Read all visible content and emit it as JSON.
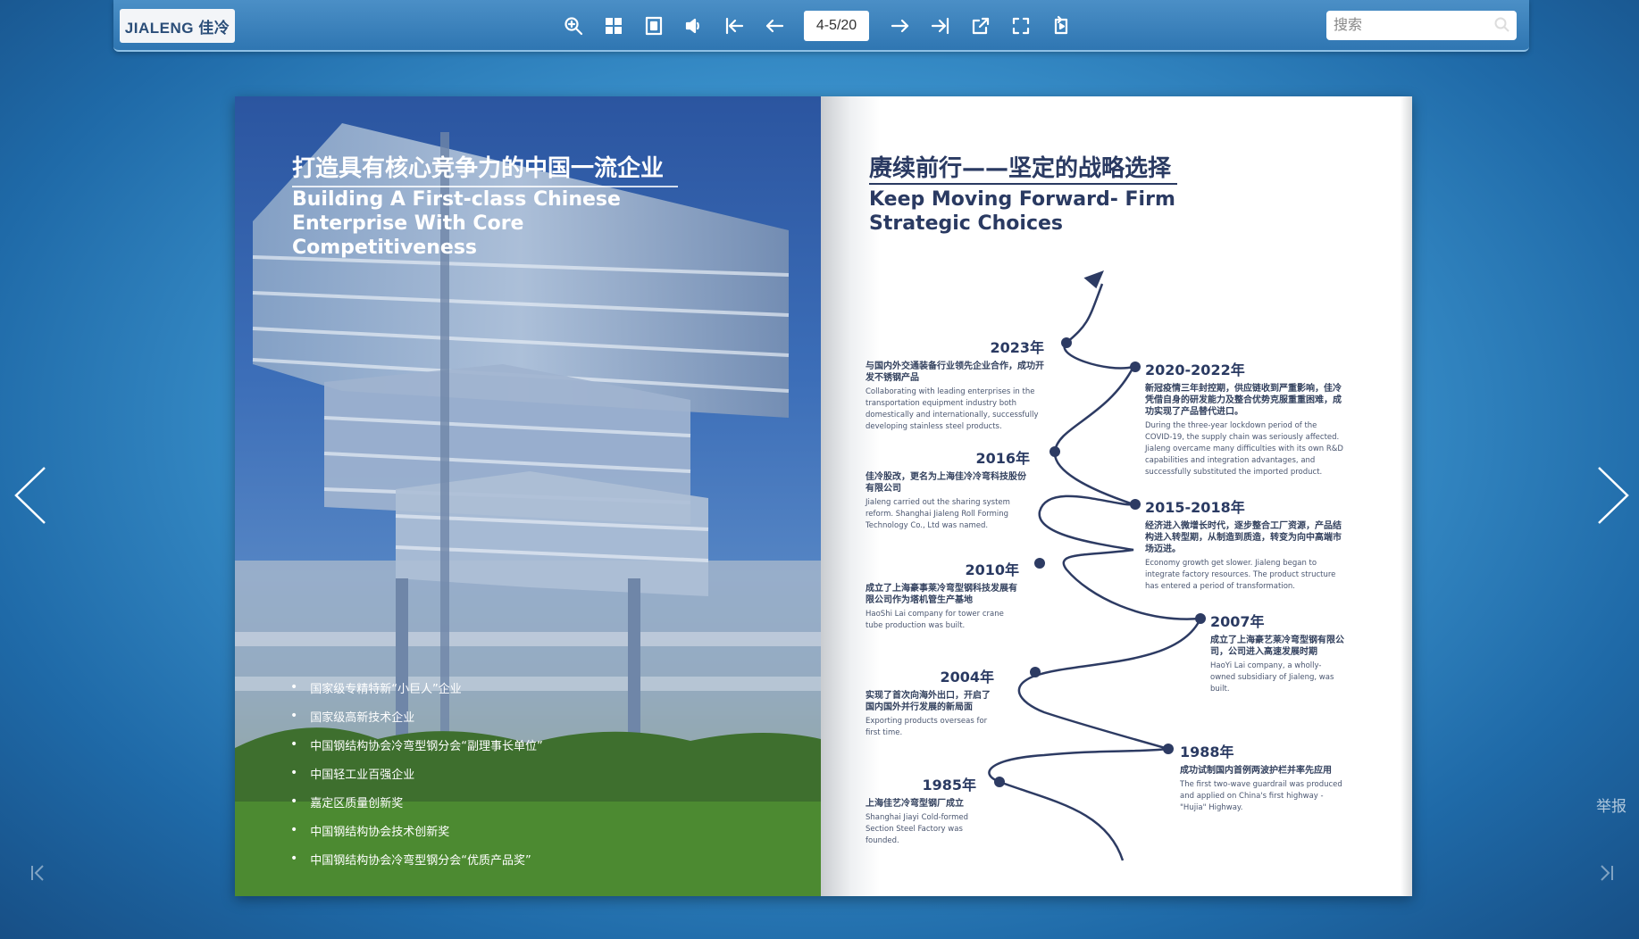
{
  "toolbar": {
    "logo": "JIALENG 佳冷",
    "page_indicator": "4-5/20",
    "search_placeholder": "搜索",
    "icons": [
      "zoom-in-icon",
      "thumbnails-icon",
      "single-page-icon",
      "sound-icon",
      "first-page-icon",
      "prev-page-icon",
      "next-page-icon",
      "last-page-icon",
      "share-icon",
      "fullscreen-icon",
      "auto-flip-icon"
    ]
  },
  "sidebar": {
    "report_label": "举报"
  },
  "left_page": {
    "title_cn": "打造具有核心竞争力的中国一流企业",
    "title_en": "Building A First-class Chinese Enterprise With Core Competitiveness",
    "honors": [
      "国家级专精特新“小巨人”企业",
      "国家级高新技术企业",
      "中国钢结构协会冷弯型钢分会“副理事长单位”",
      "中国轻工业百强企业",
      "嘉定区质量创新奖",
      "中国钢结构协会技术创新奖",
      "中国钢结构协会冷弯型钢分会“优质产品奖”"
    ]
  },
  "right_page": {
    "title_cn": "赓续前行——坚定的战略选择",
    "title_en": "Keep Moving Forward- Firm Strategic Choices",
    "events": [
      {
        "year": "2023年",
        "cn": "与国内外交通装备行业领先企业合作，成功开发不锈钢产品",
        "en": "Collaborating with leading enterprises in the transportation equipment industry both domestically and internationally, successfully developing stainless steel products."
      },
      {
        "year": "2020-2022年",
        "cn": "新冠疫情三年封控期，供应链收到严重影响，佳冷凭借自身的研发能力及整合优势克服重重困难，成功实现了产品替代进口。",
        "en": "During the three-year lockdown period of the COVID-19, the supply chain was seriously affected. Jialeng overcame many difficulties with its own R&D capabilities and integration advantages, and successfully substituted the imported product."
      },
      {
        "year": "2016年",
        "cn": "佳冷股改，更名为上海佳冷冷弯科技股份有限公司",
        "en": "Jialeng carried out the sharing system reform. Shanghai Jialeng Roll Forming Technology Co., Ltd was named."
      },
      {
        "year": "2015-2018年",
        "cn": "经济进入微增长时代，逐步整合工厂资源，产品结构进入转型期，从制造到质造，转变为向中高端市场迈进。",
        "en": "Economy growth get slower. Jialeng began to integrate factory resources. The product structure has entered a period of transformation."
      },
      {
        "year": "2010年",
        "cn": "成立了上海豪事莱冷弯型钢科技发展有限公司作为塔机管生产基地",
        "en": "HaoShi Lai company for tower crane tube production was built."
      },
      {
        "year": "2007年",
        "cn": "成立了上海豪艺莱冷弯型钢有限公司，公司进入高速发展时期",
        "en": "HaoYi Lai company, a wholly-owned subsidiary of Jialeng, was built."
      },
      {
        "year": "2004年",
        "cn": "实现了首次向海外出口，开启了国内国外并行发展的新局面",
        "en": "Exporting products overseas for first time."
      },
      {
        "year": "1988年",
        "cn": "成功试制国内首例两波护栏并率先应用",
        "en": "The first two-wave guardrail was produced and applied on China's first highway - \"Hujia\" Highway."
      },
      {
        "year": "1985年",
        "cn": "上海佳艺冷弯型钢厂成立",
        "en": "Shanghai Jiayi Cold-formed Section Steel Factory was founded."
      }
    ]
  }
}
